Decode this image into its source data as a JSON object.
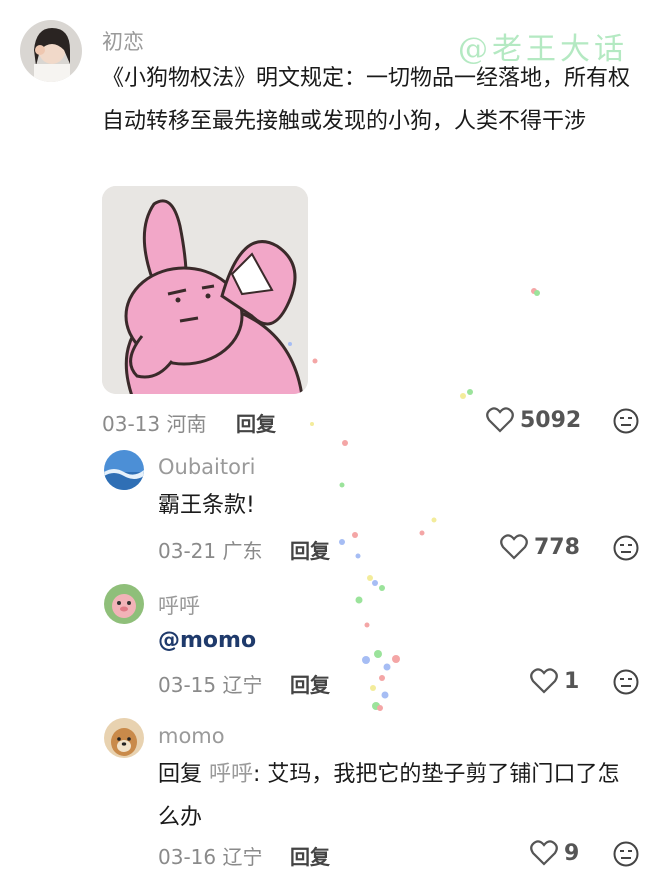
{
  "watermark": "@老王大话",
  "comments": [
    {
      "user": "初恋",
      "text": "《小狗物权法》明文规定：一切物品一经落地，所有权自动转移至最先接触或发现的小狗，人类不得干涉",
      "date": "03-13",
      "location": "河南",
      "reply_label": "回复",
      "likes": "5092"
    },
    {
      "user": "Oubaitori",
      "text": "霸王条款!",
      "date": "03-21",
      "location": "广东",
      "reply_label": "回复",
      "likes": "778"
    },
    {
      "user": "呼呼",
      "text": "@momo",
      "date": "03-15",
      "location": "辽宁",
      "reply_label": "回复",
      "likes": "1"
    },
    {
      "user": "momo",
      "reply_prefix": "回复",
      "reply_to": "呼呼",
      "text": ": 艾玛，我把它的垫子剪了铺门口了怎么办",
      "date": "03-16",
      "location": "辽宁",
      "reply_label": "回复",
      "likes": "9"
    }
  ],
  "icons": {
    "like": "heart-outline-icon",
    "dislike": "meh-face-icon"
  },
  "colors": {
    "mention": "#1f3a6b",
    "watermark": "#a8e6b8",
    "sticker_pink": "#f2a7c8"
  }
}
